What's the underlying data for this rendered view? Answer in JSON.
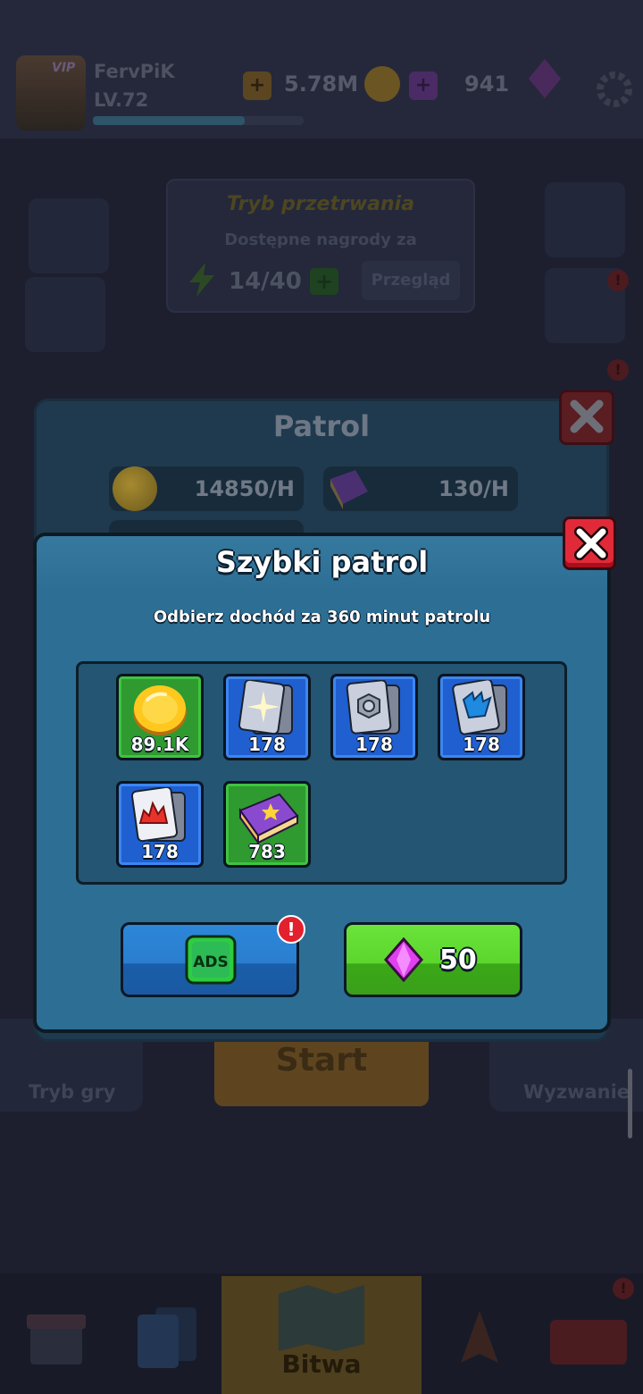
{
  "player": {
    "vip_label": "VIP",
    "name": "FervPiK",
    "level": "LV.72",
    "xp_progress": 0.72
  },
  "currencies": {
    "gold": "5.78M",
    "gems": "941"
  },
  "game_mode": {
    "title": "Tryb przetrwania",
    "subtitle": "Dostępne nagrody za",
    "energy": "14/40",
    "preview_label": "Przegląd"
  },
  "bottom_actions": {
    "mode_label": "Tryb gry",
    "start_label": "Start",
    "challenge_label": "Wyzwanie"
  },
  "bottom_nav": {
    "battle_label": "Bitwa"
  },
  "patrol": {
    "title": "Patrol",
    "gold_rate": "14850/H",
    "book_rate": "130/H"
  },
  "quick_patrol": {
    "title": "Szybki patrol",
    "subtitle": "Odbierz dochód za 360 minut patrolu",
    "rewards": [
      {
        "icon": "gold-coin-icon",
        "quantity": "89.1K",
        "frame": "green"
      },
      {
        "icon": "sparkle-card-icon",
        "quantity": "178",
        "frame": "blue"
      },
      {
        "icon": "nut-card-icon",
        "quantity": "178",
        "frame": "blue"
      },
      {
        "icon": "blue-hand-card-icon",
        "quantity": "178",
        "frame": "blue"
      },
      {
        "icon": "fire-card-icon",
        "quantity": "178",
        "frame": "blue"
      },
      {
        "icon": "purple-book-icon",
        "quantity": "783",
        "frame": "green"
      }
    ],
    "ads_label": "ADS",
    "gem_price": "50",
    "alert_mark": "!"
  },
  "colors": {
    "dialog_blue": "#2d6e94",
    "tile_green": "#2e9a30",
    "tile_blue": "#1f5fd0",
    "close_red": "#e02a3a",
    "ads_button": "#2a7ecf",
    "gem_button": "#5cd62c"
  }
}
